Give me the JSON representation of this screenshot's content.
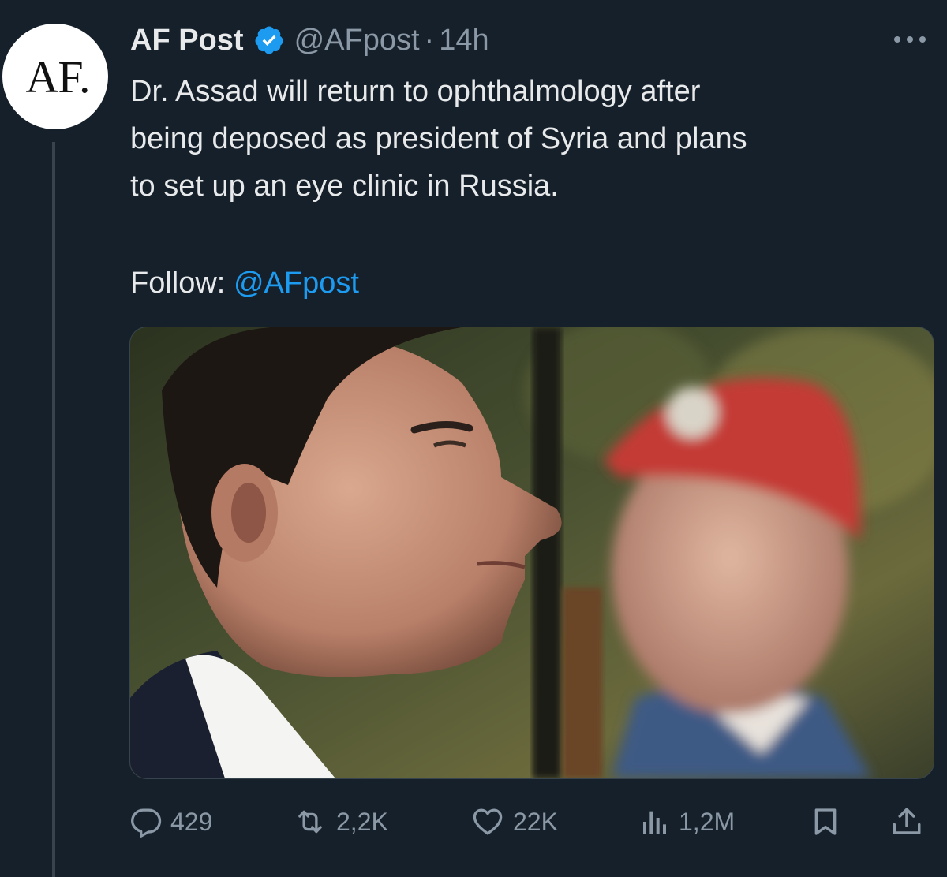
{
  "avatar": {
    "text": "AF."
  },
  "author": {
    "name": "AF Post",
    "handle": "@AFpost",
    "separator": "·",
    "time": "14h",
    "verified": true
  },
  "tweet": {
    "lines": [
      "Dr. Assad will return to ophthalmology after",
      "being deposed as president of Syria and plans",
      "to set up an eye clinic in Russia."
    ],
    "follow_label": "Follow:",
    "follow_mention": "@AFpost"
  },
  "actions": {
    "replies": "429",
    "retweets": "2,2K",
    "likes": "22K",
    "views": "1,2M"
  },
  "colors": {
    "background": "#15202b",
    "text": "#e7e9ea",
    "muted": "#8b98a5",
    "accent": "#1d9bf0"
  },
  "icons": [
    "verified-badge-icon",
    "more-options-icon",
    "reply-icon",
    "retweet-icon",
    "like-icon",
    "views-icon",
    "bookmark-icon",
    "share-icon"
  ]
}
